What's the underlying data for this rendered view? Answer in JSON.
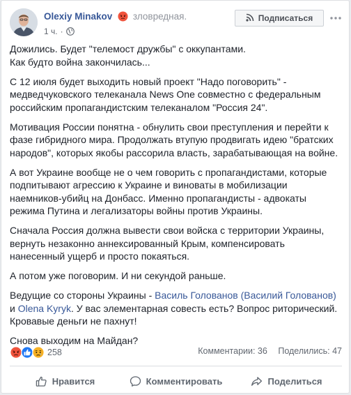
{
  "post": {
    "author": "Olexiy Minakov",
    "feeling": "зловредная.",
    "time": "1 ч.",
    "subscribe_label": "Подписаться",
    "paragraphs": [
      {
        "lines": [
          "Дожились. Будет \"телемост дружбы\" с оккупантами.",
          "Как будто война закончилась..."
        ]
      },
      {
        "lines": [
          "С 12 июля будет выходить новый проект \"Надо поговорить\" -",
          "медведчуковского телеканала News One совместно с федеральным",
          "российским пропагандистским телеканалом \"Россия 24\"."
        ]
      },
      {
        "lines": [
          "Мотивация России понятна - обнулить свои преступления и перейти к",
          "фазе гибридного мира. Продолжать втупую продвигать идею \"братских",
          "народов\", которых якобы рассорила власть, зарабатывающая на войне."
        ]
      },
      {
        "lines": [
          "А вот Украине вообще не о чем говорить с пропагандистами, которые",
          "подпитывают агрессию к Украине и виноваты в мобилизации",
          "наемников-убийц на Донбасс. Именно пропагандисты - адвокаты",
          "режима Путина и легализаторы войны против Украины."
        ]
      },
      {
        "lines": [
          "Сначала Россия должна вывести свои войска с территории Украины,",
          "вернуть незаконно аннексированный Крым, компенсировать",
          "нанесенный ущерб и просто покаяться."
        ]
      },
      {
        "lines": [
          "А потом уже поговорим. И ни секундой раньше."
        ]
      }
    ],
    "mention": {
      "prefix": "Ведущие со стороны Украины - ",
      "link1": "Василь Голованов (Василий Голованов)",
      "mid": "и ",
      "link2": "Olena Kyryk",
      "rest1": ". У вас элементарная совесть есть? Вопрос риторический.",
      "line3": "Кровавые деньги не пахнут!"
    },
    "closing": "Снова выходим на Майдан?"
  },
  "reactions": {
    "icons": [
      "angry-icon",
      "like-icon",
      "sad-icon"
    ],
    "count": "258"
  },
  "stats": {
    "comments": "Комментарии: 36",
    "shares": "Поделились: 47"
  },
  "actions": {
    "like": "Нравится",
    "comment": "Комментировать",
    "share": "Поделиться"
  },
  "colors": {
    "link": "#385898",
    "text": "#1d2129",
    "secondary": "#616770",
    "like_blue": "#2078f4",
    "angry_red": "#f0533c",
    "sad_yellow": "#f7b125"
  }
}
